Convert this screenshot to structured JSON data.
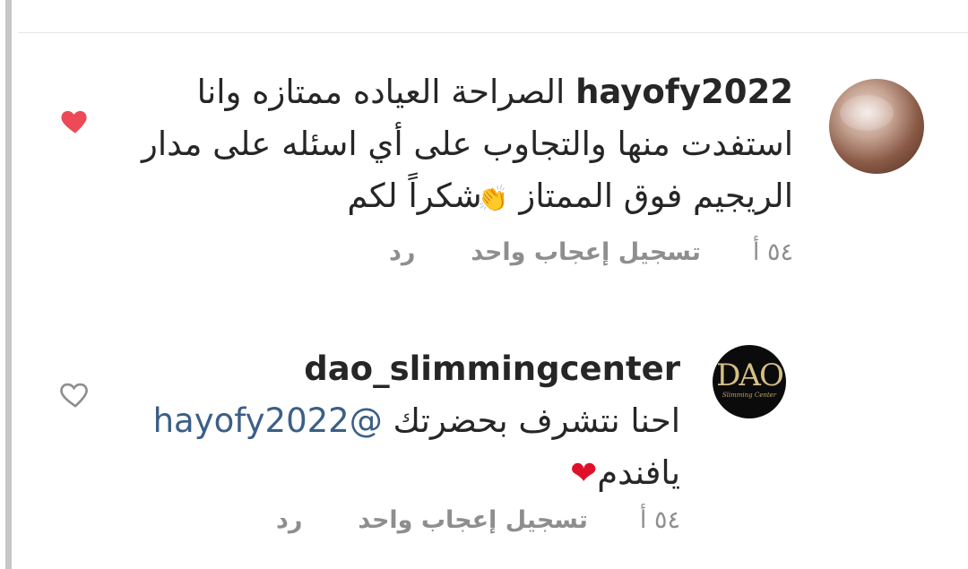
{
  "comments": [
    {
      "username": "hayofy2022",
      "text_lines": [
        "الصراحة العياده ممتازه وانا",
        "استفدت منها والتجاوب على أي اسئله على مدار",
        "الريجيم فوق الممتاز",
        "شكراً لكم"
      ],
      "emoji": "clapping-hands",
      "time": "٥٤ أ",
      "like_label": "تسجيل إعجاب واحد",
      "reply_label": "رد",
      "liked": true,
      "heart_color": "#ed4956",
      "avatar_icon": "profile-photo"
    },
    {
      "username": "dao_slimmingcenter",
      "text_line1": "احنا نتشرف بحضرتك",
      "mention": "@hayofy2022",
      "text_line2": "يافندم",
      "emoji": "red-heart",
      "time": "٥٤ أ",
      "like_label": "تسجيل إعجاب واحد",
      "reply_label": "رد",
      "liked": false,
      "avatar_logo": "DAO",
      "avatar_logo_sub": "Slimming Center"
    }
  ],
  "colors": {
    "text": "#262626",
    "meta": "#8e8e8e",
    "mention": "#3b5f87",
    "like_active": "#ed4956"
  }
}
